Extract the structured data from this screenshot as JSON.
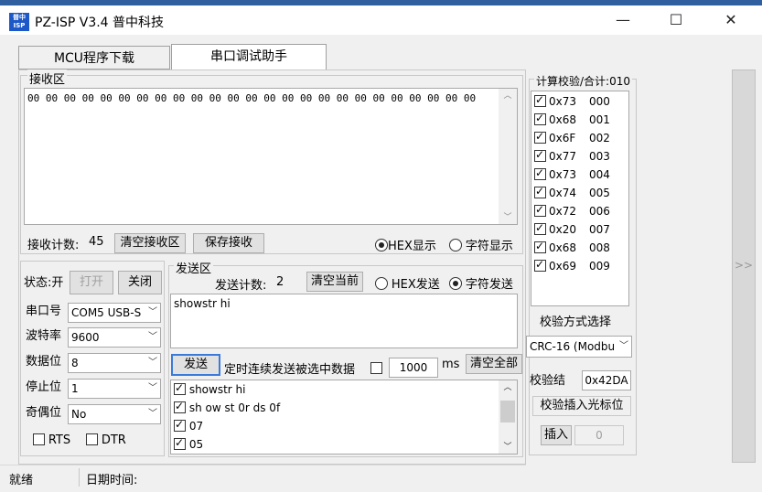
{
  "window": {
    "title": "PZ-ISP V3.4 普中科技",
    "icon_text": "普中ISP",
    "controls": {
      "minimize": "—",
      "maximize": "☐",
      "close": "✕"
    }
  },
  "tabs": [
    {
      "label": "MCU程序下载",
      "active": false
    },
    {
      "label": "串口调试助手",
      "active": true
    }
  ],
  "receive": {
    "group_label": "接收区",
    "data": "00 00 00 00 00 00 00 00 00 00 00 00 00 00 00 00 00 00 00 00 00 00 00 00 00",
    "count_label": "接收计数:",
    "count_value": "45",
    "clear_button": "清空接收区",
    "save_button": "保存接收",
    "hex_display": "HEX显示",
    "char_display": "字符显示",
    "hex_selected": true
  },
  "serial": {
    "status_label": "状态:开",
    "open_button": "打开",
    "close_button": "关闭",
    "port_label": "串口号",
    "port_value": "COM5  USB-S",
    "baud_label": "波特率",
    "baud_value": "9600",
    "databits_label": "数据位",
    "databits_value": "8",
    "stopbits_label": "停止位",
    "stopbits_value": "1",
    "parity_label": "奇偶位",
    "parity_value": "No",
    "rts_label": "RTS",
    "dtr_label": "DTR"
  },
  "send": {
    "group_label": "发送区",
    "count_label": "发送计数:",
    "count_value": "2",
    "clear_current": "清空当前",
    "hex_send": "HEX发送",
    "char_send": "字符发送",
    "char_selected": true,
    "text": "showstr hi",
    "send_button": "发送",
    "timer_label": "定时连续发送被选中数据",
    "interval_value": "1000",
    "interval_unit": "ms",
    "clear_all": "清空全部",
    "items": [
      {
        "text": "showstr hi",
        "checked": true
      },
      {
        "text": "sh ow st 0r ds 0f",
        "checked": true
      },
      {
        "text": "07",
        "checked": true
      },
      {
        "text": "05",
        "checked": true
      }
    ]
  },
  "checksum": {
    "group_label": "计算校验/合计:010",
    "rows": [
      {
        "hex": "0x73",
        "idx": "000"
      },
      {
        "hex": "0x68",
        "idx": "001"
      },
      {
        "hex": "0x6F",
        "idx": "002"
      },
      {
        "hex": "0x77",
        "idx": "003"
      },
      {
        "hex": "0x73",
        "idx": "004"
      },
      {
        "hex": "0x74",
        "idx": "005"
      },
      {
        "hex": "0x72",
        "idx": "006"
      },
      {
        "hex": "0x20",
        "idx": "007"
      },
      {
        "hex": "0x68",
        "idx": "008"
      },
      {
        "hex": "0x69",
        "idx": "009"
      }
    ],
    "method_label": "校验方式选择",
    "method_value": "CRC-16 (Modbu",
    "result_label": "校验结",
    "result_value": "0x42DA",
    "insert_cursor_label": "校验插入光标位",
    "insert_button": "插入",
    "insert_value": "0"
  },
  "expand_glyph": ">>",
  "statusbar": {
    "ready": "就绪",
    "datetime_label": "日期时间:"
  }
}
